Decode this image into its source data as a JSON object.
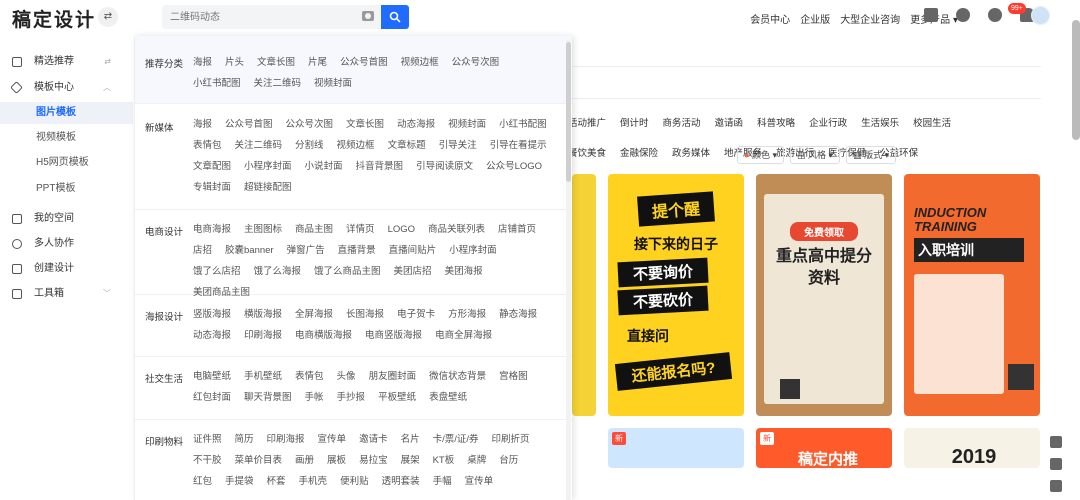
{
  "header": {
    "logo": "稿定设计",
    "search_placeholder": "二维码动态",
    "nav": [
      "会员中心",
      "企业版",
      "大型企业咨询",
      "更多产品"
    ],
    "badge": "99+"
  },
  "sidebar": {
    "items": [
      {
        "label": "精选推荐"
      },
      {
        "label": "模板中心"
      },
      {
        "label": "图片模板"
      },
      {
        "label": "视频模板"
      },
      {
        "label": "H5网页模板"
      },
      {
        "label": "PPT模板"
      },
      {
        "label": "我的空间"
      },
      {
        "label": "多人协作"
      },
      {
        "label": "创建设计"
      },
      {
        "label": "工具箱"
      }
    ]
  },
  "content": {
    "cat_row1": [
      "活动推广",
      "倒计时",
      "商务活动",
      "邀请函",
      "科普攻略",
      "企业行政",
      "生活娱乐",
      "校园生活"
    ],
    "cat_row2": [
      "餐饮美食",
      "金融保险",
      "政务媒体",
      "地产服务",
      "旅游出行",
      "医疗保健",
      "公益环保"
    ],
    "filters": [
      "颜色",
      "风格",
      "版式"
    ],
    "posters": {
      "p1_top": "提个醒",
      "p1_a": "接下来的日子",
      "p1_b": "不要询价",
      "p1_c": "不要砍价",
      "p1_d": "直接问",
      "p1_e": "还能报名吗?",
      "p2_top": "免费领取",
      "p2_main": "重点高中提分资料",
      "p3_a": "INDUCTION TRAINING",
      "p3_b": "入职培训",
      "r2_a": "新",
      "r2_b": "稿定内推",
      "r2_c": "2019"
    }
  },
  "dropdown": {
    "sections": [
      {
        "title": "推荐分类",
        "links": [
          "海报",
          "片头",
          "文章长图",
          "片尾",
          "公众号首图",
          "视频边框",
          "公众号次图",
          "小红书配图",
          "关注二维码",
          "视频封面"
        ]
      },
      {
        "title": "新媒体",
        "links": [
          "海报",
          "公众号首图",
          "公众号次图",
          "文章长图",
          "动态海报",
          "视频封面",
          "小红书配图",
          "表情包",
          "关注二维码",
          "分割线",
          "视频边框",
          "文章标题",
          "引导关注",
          "引导在看提示",
          "文章配图",
          "小程序封面",
          "小说封面",
          "抖音背景图",
          "引导阅读原文",
          "公众号LOGO",
          "专辑封面",
          "超链接配图"
        ]
      },
      {
        "title": "电商设计",
        "links": [
          "电商海报",
          "主图图标",
          "商品主图",
          "详情页",
          "LOGO",
          "商品关联列表",
          "店铺首页",
          "店招",
          "胶囊banner",
          "弹窗广告",
          "直播背景",
          "直播间贴片",
          "小程序封面",
          "饿了么店招",
          "饿了么海报",
          "饿了么商品主图",
          "美团店招",
          "美团海报",
          "美团商品主图"
        ]
      },
      {
        "title": "海报设计",
        "links": [
          "竖版海报",
          "横版海报",
          "全屏海报",
          "长图海报",
          "电子贺卡",
          "方形海报",
          "静态海报",
          "动态海报",
          "印刷海报",
          "电商横版海报",
          "电商竖版海报",
          "电商全屏海报"
        ]
      },
      {
        "title": "社交生活",
        "links": [
          "电脑壁纸",
          "手机壁纸",
          "表情包",
          "头像",
          "朋友圈封面",
          "微信状态背景",
          "宫格图",
          "红包封面",
          "聊天背景图",
          "手帐",
          "手抄报",
          "平板壁纸",
          "表盘壁纸"
        ]
      },
      {
        "title": "印刷物料",
        "links": [
          "证件照",
          "简历",
          "印刷海报",
          "宣传单",
          "邀请卡",
          "名片",
          "卡/票/证/券",
          "印刷折页",
          "不干胶",
          "菜单价目表",
          "画册",
          "展板",
          "易拉宝",
          "展架",
          "KT板",
          "桌牌",
          "台历",
          "红包",
          "手提袋",
          "杯套",
          "手机壳",
          "便利贴",
          "透明套装",
          "手幅",
          "宣传单"
        ]
      }
    ]
  }
}
